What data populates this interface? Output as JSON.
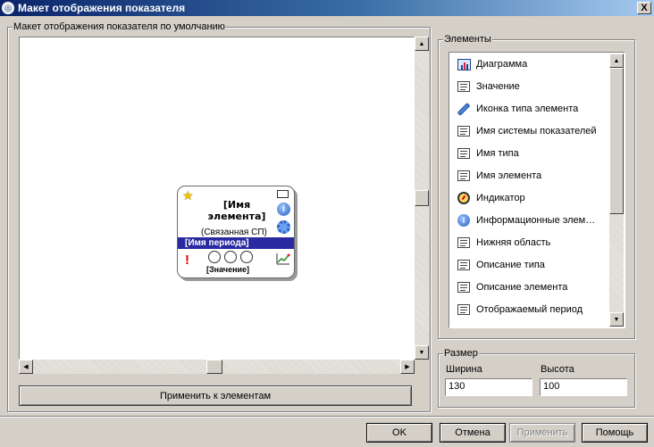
{
  "window": {
    "title": "Макет отображения показателя",
    "close_label": "X"
  },
  "layout_group": {
    "label": "Макет отображения показателя по умолчанию"
  },
  "card": {
    "name": "[Имя элемента]",
    "related": "(Связанная СП)",
    "period": "[Имя периода]",
    "value": "[Значение]",
    "exclamation": "!"
  },
  "apply_elements_label": "Применить к элементам",
  "elements_group": {
    "label": "Элементы",
    "items": [
      {
        "label": "Диаграмма",
        "icon": "chart-icon"
      },
      {
        "label": "Значение",
        "icon": "field-icon"
      },
      {
        "label": "Иконка типа элемента",
        "icon": "pencil-icon"
      },
      {
        "label": "Имя системы показателей",
        "icon": "field-icon"
      },
      {
        "label": "Имя типа",
        "icon": "field-icon"
      },
      {
        "label": "Имя элемента",
        "icon": "field-icon"
      },
      {
        "label": "Индикатор",
        "icon": "gauge-icon"
      },
      {
        "label": "Информационные элем…",
        "icon": "info-icon"
      },
      {
        "label": "Нижняя область",
        "icon": "field-icon"
      },
      {
        "label": "Описание типа",
        "icon": "field-icon"
      },
      {
        "label": "Описание элемента",
        "icon": "field-icon"
      },
      {
        "label": "Отображаемый период",
        "icon": "field-icon"
      }
    ]
  },
  "size_group": {
    "label": "Размер",
    "width_label": "Ширина",
    "height_label": "Высота",
    "width_value": "130",
    "height_value": "100"
  },
  "buttons": {
    "ok": "OK",
    "cancel": "Отмена",
    "apply": "Применить",
    "help": "Помощь"
  }
}
